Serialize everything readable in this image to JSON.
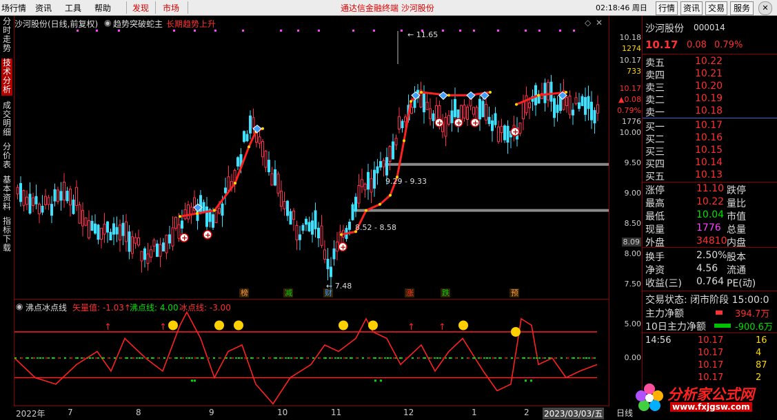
{
  "menubar": {
    "items": [
      "场行情",
      "资讯",
      "工具",
      "帮助",
      "发现",
      "市场"
    ],
    "ticker": "通达信金融终端  沙河股份",
    "clock": "02:18:46 周日",
    "buttons": [
      "行情",
      "资讯",
      "交易",
      "服务"
    ]
  },
  "left_tabs": [
    "分时走势",
    "技术分析",
    "成交明细",
    "分价表",
    "基本资料",
    "指标下载"
  ],
  "main_chart": {
    "title": "沙河股份(日线,前复权)",
    "indicator": "趋势突破蛇主",
    "indicator_status": "长期趋势上升",
    "y_ticks": [
      "10.18",
      "10.00",
      "9.50",
      "9.00",
      "8.50",
      "8.00",
      "7.50"
    ],
    "y_axis_extra": [
      {
        "text": "1274",
        "color": "#ffd800"
      },
      {
        "text": "10.17",
        "color": "#ddd"
      },
      {
        "text": "733",
        "color": "#ffd800"
      },
      {
        "text": "10.17",
        "color": "#ff3030"
      },
      {
        "text": "▲0.08",
        "color": "#ff3030"
      },
      {
        "text": "0.79%",
        "color": "#ff3030"
      },
      {
        "text": "1776",
        "color": "#ddd"
      },
      {
        "text": "8.09",
        "color": "#ddd"
      }
    ],
    "annotations": {
      "high": "11.65",
      "low": "7.48",
      "zone_upper": "9.29 - 9.33",
      "zone_lower": "8.52 - 8.58"
    },
    "bottom_tags": [
      "榜",
      "减",
      "财",
      "涨",
      "跌",
      "预"
    ]
  },
  "sub_chart": {
    "title": "沸点冰点线",
    "vector_label": "矢量值: -1.03↑",
    "boil_label": "沸点线: 4.00",
    "ice_label": "冰点线: -3.00",
    "y_ticks": [
      "5.00",
      "0.00"
    ]
  },
  "x_axis": [
    "2022年",
    "7",
    "8",
    "9",
    "10",
    "11",
    "12",
    "1",
    "2",
    "2023/03/03/五"
  ],
  "x_axis_right": "日线",
  "quote": {
    "name": "沙河股份",
    "code": "000014",
    "price": "10.17",
    "change": "0.08",
    "pct": "0.79%",
    "asks": [
      {
        "label": "卖五",
        "price": "10.22"
      },
      {
        "label": "卖四",
        "price": "10.21"
      },
      {
        "label": "卖三",
        "price": "10.20"
      },
      {
        "label": "卖二",
        "price": "10.19"
      },
      {
        "label": "卖一",
        "price": "10.18"
      }
    ],
    "bids": [
      {
        "label": "买一",
        "price": "10.17"
      },
      {
        "label": "买二",
        "price": "10.16"
      },
      {
        "label": "买三",
        "price": "10.15"
      },
      {
        "label": "买四",
        "price": "10.14"
      },
      {
        "label": "买五",
        "price": "10.13"
      }
    ],
    "stats": [
      {
        "label": "涨停",
        "value": "11.10",
        "label2": "跌停",
        "color": "#ff3030"
      },
      {
        "label": "最高",
        "value": "10.22",
        "label2": "量比",
        "color": "#ff3030"
      },
      {
        "label": "最低",
        "value": "10.04",
        "label2": "市值",
        "color": "#00e000"
      },
      {
        "label": "现量",
        "value": "1776",
        "label2": "总量",
        "color": "#ff40ff"
      },
      {
        "label": "外盘",
        "value": "34810",
        "label2": "内盘",
        "color": "#ff3030"
      }
    ],
    "stats2": [
      {
        "label": "换手",
        "value": "2.50%",
        "label2": "股本"
      },
      {
        "label": "净资",
        "value": "4.56",
        "label2": "流通"
      },
      {
        "label": "收益(三)",
        "value": "0.764",
        "label2": "PE(动)"
      }
    ],
    "trade_status": "交易状态: 闭市阶段 15:00:0",
    "main_flow": {
      "label": "主力净额",
      "value": "394.7万"
    },
    "main_flow_10": {
      "label": "10日主力净额",
      "value": "-900.6万"
    },
    "ticks": [
      {
        "time": "14:56",
        "price": "10.17",
        "vol": "16"
      },
      {
        "time": "",
        "price": "10.17",
        "vol": "4"
      },
      {
        "time": "",
        "price": "10.17",
        "vol": "87"
      },
      {
        "time": "",
        "price": "10.17",
        "vol": "2"
      }
    ],
    "watermark": "分析家公式网",
    "watermark_url": "www.fxjgsw.com"
  }
}
